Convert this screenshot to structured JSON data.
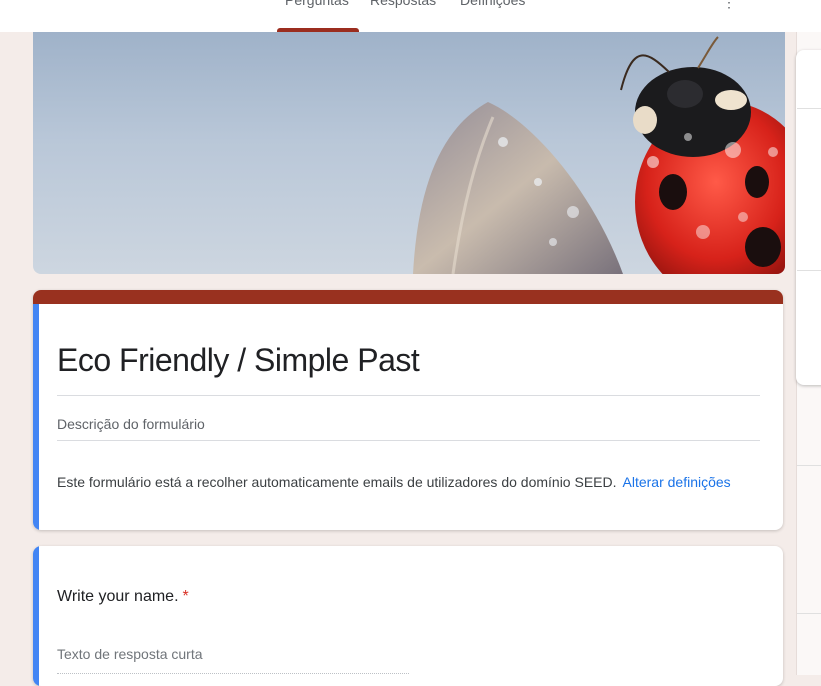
{
  "tabs": [
    {
      "label": "Perguntas"
    },
    {
      "label": "Respostas"
    },
    {
      "label": "Definições"
    }
  ],
  "form": {
    "title": "Eco Friendly / Simple Past",
    "description_placeholder": "Descrição do formulário",
    "email_notice": "Este formulário está a recolher automaticamente emails de utilizadores do domínio SEED.",
    "email_link": "Alterar definições"
  },
  "question": {
    "title": "Write your name.",
    "required_mark": "*",
    "answer_placeholder": "Texto de resposta curta"
  },
  "colors": {
    "theme": "#99311f",
    "accent": "#4285f4",
    "link": "#1a73e8",
    "required": "#d93025"
  }
}
